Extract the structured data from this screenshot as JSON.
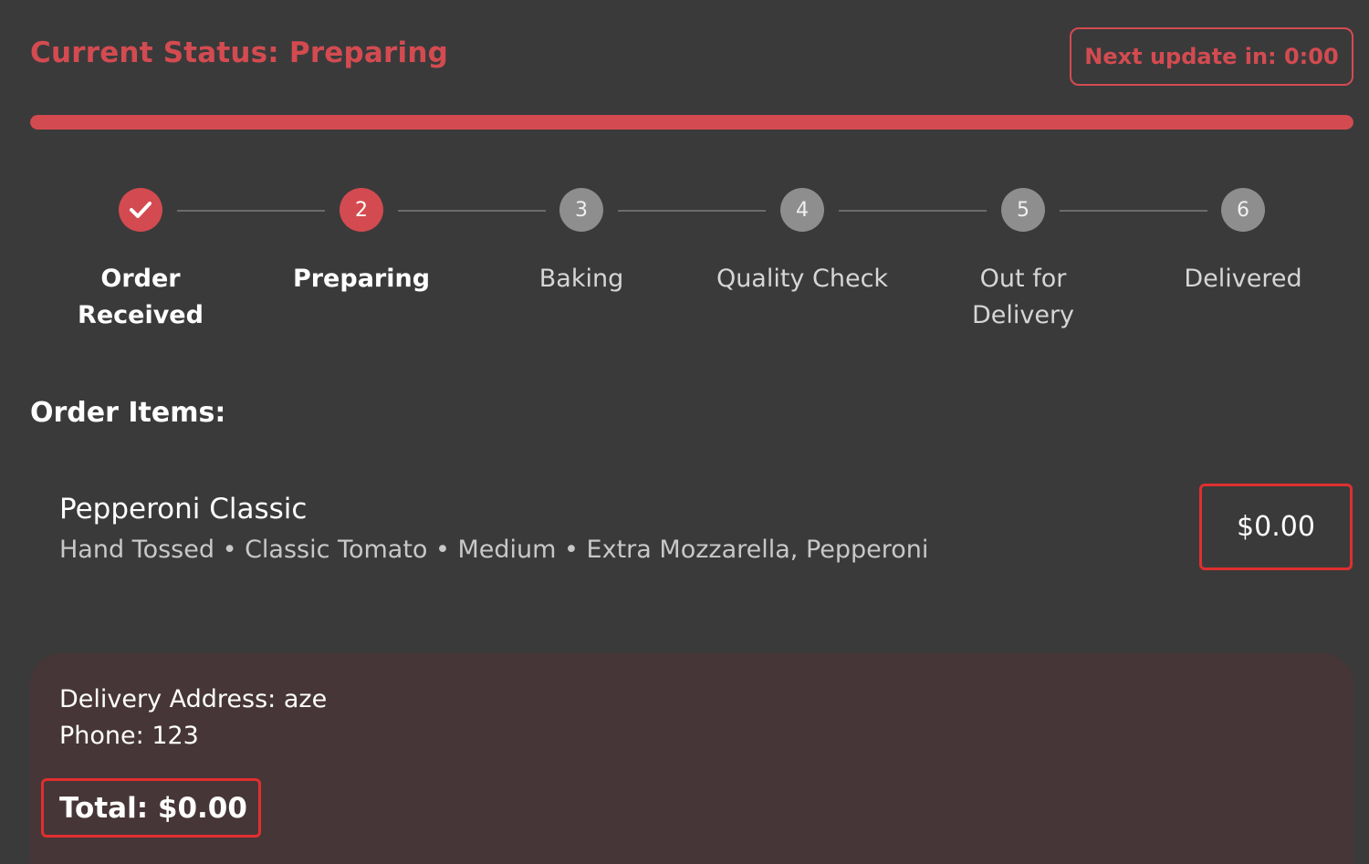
{
  "header": {
    "status_title": "Current Status: Preparing",
    "next_update": "Next update in: 0:00"
  },
  "progress": {
    "fill_fraction": 1.0
  },
  "colors": {
    "accent": "#d34b50",
    "highlight_border": "#e02f2f",
    "background": "#3a3a3b",
    "pending_step": "#8e8e8e",
    "summary_card": "#473637"
  },
  "steps": [
    {
      "number": "",
      "icon": "check-icon",
      "label": "Order Received",
      "state": "done"
    },
    {
      "number": "2",
      "label": "Preparing",
      "state": "active"
    },
    {
      "number": "3",
      "label": "Baking",
      "state": "pending"
    },
    {
      "number": "4",
      "label": "Quality Check",
      "state": "pending"
    },
    {
      "number": "5",
      "label": "Out for Delivery",
      "state": "pending"
    },
    {
      "number": "6",
      "label": "Delivered",
      "state": "pending"
    }
  ],
  "order": {
    "heading": "Order Items:",
    "items": [
      {
        "name": "Pepperoni Classic",
        "details": "Hand Tossed • Classic Tomato • Medium • Extra Mozzarella, Pepperoni",
        "price": "$0.00"
      }
    ]
  },
  "summary": {
    "address": "Delivery Address: aze",
    "phone": "Phone: 123",
    "total": "Total: $0.00"
  }
}
